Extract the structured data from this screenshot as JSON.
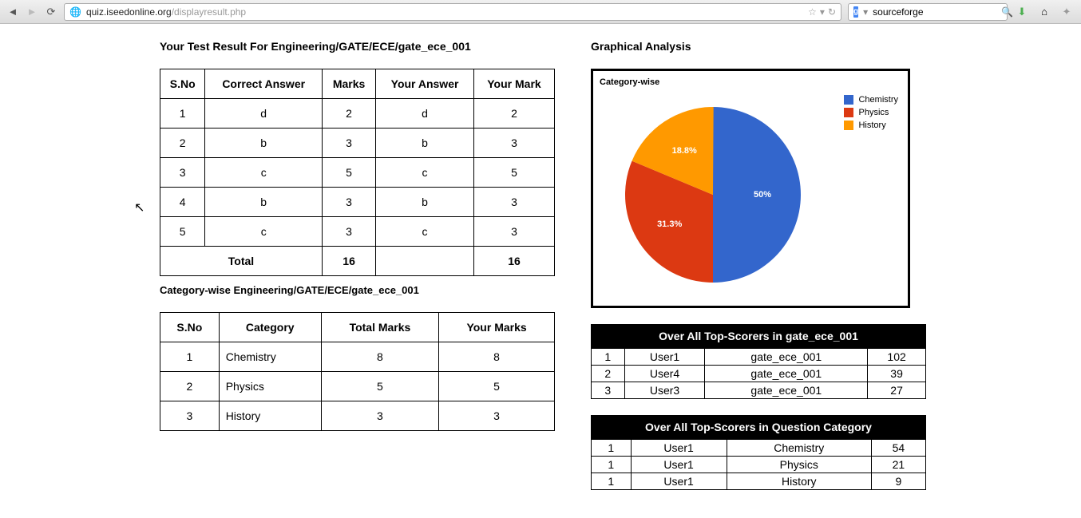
{
  "browser": {
    "url_domain": "quiz.iseedonline.org",
    "url_path": "/displayresult.php",
    "search_value": "sourceforge"
  },
  "left": {
    "title": "Your Test Result For Engineering/GATE/ECE/gate_ece_001",
    "table": {
      "headers": [
        "S.No",
        "Correct Answer",
        "Marks",
        "Your Answer",
        "Your Mark"
      ],
      "rows": [
        [
          "1",
          "d",
          "2",
          "d",
          "2"
        ],
        [
          "2",
          "b",
          "3",
          "b",
          "3"
        ],
        [
          "3",
          "c",
          "5",
          "c",
          "5"
        ],
        [
          "4",
          "b",
          "3",
          "b",
          "3"
        ],
        [
          "5",
          "c",
          "3",
          "c",
          "3"
        ]
      ],
      "total_label": "Total",
      "total_marks": "16",
      "total_yourmark": "16"
    },
    "cat_title": "Category-wise Engineering/GATE/ECE/gate_ece_001",
    "cat_table": {
      "headers": [
        "S.No",
        "Category",
        "Total Marks",
        "Your Marks"
      ],
      "rows": [
        [
          "1",
          "Chemistry",
          "8",
          "8"
        ],
        [
          "2",
          "Physics",
          "5",
          "5"
        ],
        [
          "3",
          "History",
          "3",
          "3"
        ]
      ]
    }
  },
  "right": {
    "title": "Graphical Analysis",
    "chart_box_title": "Category-wise",
    "scorer1_title": "Over All Top-Scorers in gate_ece_001",
    "scorer1_rows": [
      [
        "1",
        "User1",
        "gate_ece_001",
        "102"
      ],
      [
        "2",
        "User4",
        "gate_ece_001",
        "39"
      ],
      [
        "3",
        "User3",
        "gate_ece_001",
        "27"
      ]
    ],
    "scorer2_title": "Over All Top-Scorers in Question Category",
    "scorer2_rows": [
      [
        "1",
        "User1",
        "Chemistry",
        "54"
      ],
      [
        "1",
        "User1",
        "Physics",
        "21"
      ],
      [
        "1",
        "User1",
        "History",
        "9"
      ]
    ]
  },
  "chart_data": {
    "type": "pie",
    "title": "Category-wise",
    "series": [
      {
        "name": "Chemistry",
        "value": 50,
        "label": "50%",
        "color": "#3366cc"
      },
      {
        "name": "Physics",
        "value": 31.3,
        "label": "31.3%",
        "color": "#dc3912"
      },
      {
        "name": "History",
        "value": 18.8,
        "label": "18.8%",
        "color": "#ff9900"
      }
    ]
  }
}
